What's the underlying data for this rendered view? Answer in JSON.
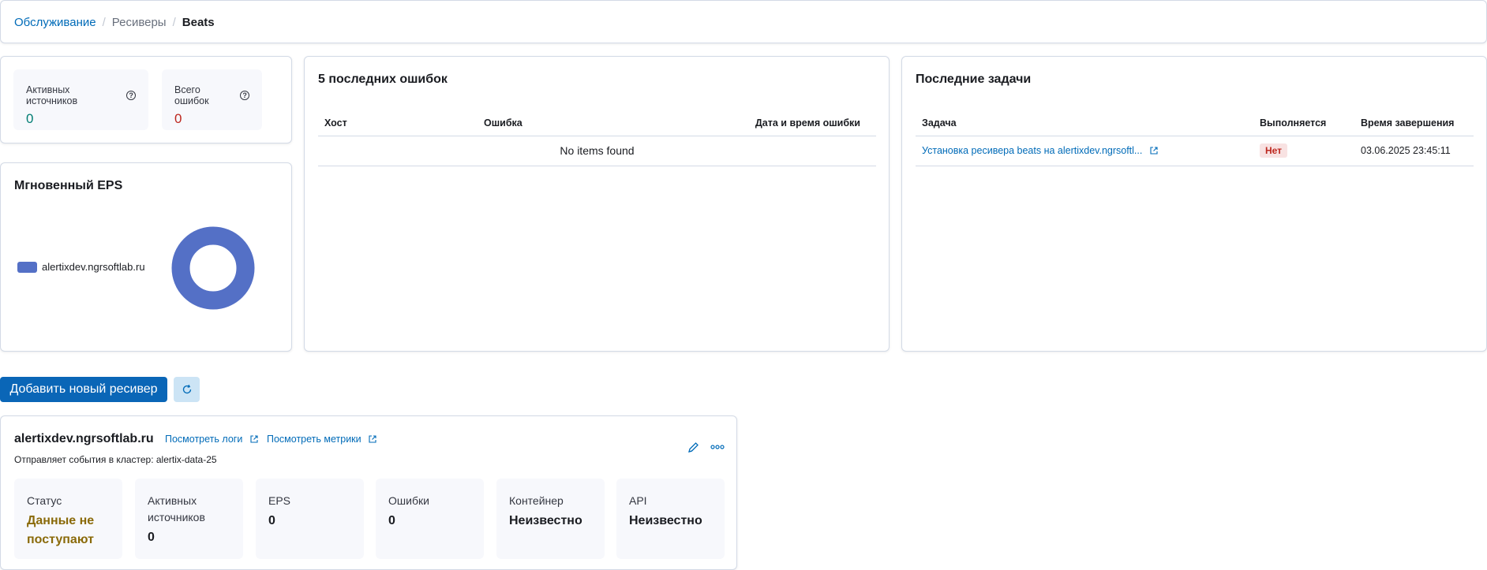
{
  "breadcrumb": {
    "root": "Обслуживание",
    "parent": "Ресиверы",
    "current": "Beats"
  },
  "stats": {
    "active_sources_label": "Активных источников",
    "active_sources_value": "0",
    "total_errors_label": "Всего ошибок",
    "total_errors_value": "0",
    "active_color": "#017d73",
    "errors_color": "#bd271e"
  },
  "eps": {
    "title": "Мгновенный EPS",
    "legend_label": "alertixdev.ngrsoftlab.ru",
    "series_color": "#5470c6"
  },
  "errors": {
    "title": "5 последних ошибок",
    "columns": [
      "Хост",
      "Ошибка",
      "Дата и время ошибки"
    ],
    "empty_text": "No items found"
  },
  "tasks": {
    "title": "Последние задачи",
    "columns": [
      "Задача",
      "Выполняется",
      "Время завершения"
    ],
    "rows": [
      {
        "task": "Установка ресивера beats на alertixdev.ngrsoftl...",
        "running": "Нет",
        "finished": "03.06.2025 23:45:11"
      }
    ]
  },
  "actions": {
    "add_label": "Добавить новый ресивер",
    "refresh_icon": "refresh-icon"
  },
  "receiver": {
    "name": "alertixdev.ngrsoftlab.ru",
    "logs_link": "Посмотреть логи",
    "metrics_link": "Посмотреть метрики",
    "subtitle": "Отправляет события в кластер: alertix-data-25",
    "metrics": [
      {
        "label": "Статус",
        "value": "Данные не поступают"
      },
      {
        "label": "Активных источников",
        "value": "0"
      },
      {
        "label": "EPS",
        "value": "0"
      },
      {
        "label": "Ошибки",
        "value": "0"
      },
      {
        "label": "Контейнер",
        "value": "Неизвестно"
      },
      {
        "label": "API",
        "value": "Неизвестно"
      }
    ],
    "status_color": "#8a6a0a"
  }
}
